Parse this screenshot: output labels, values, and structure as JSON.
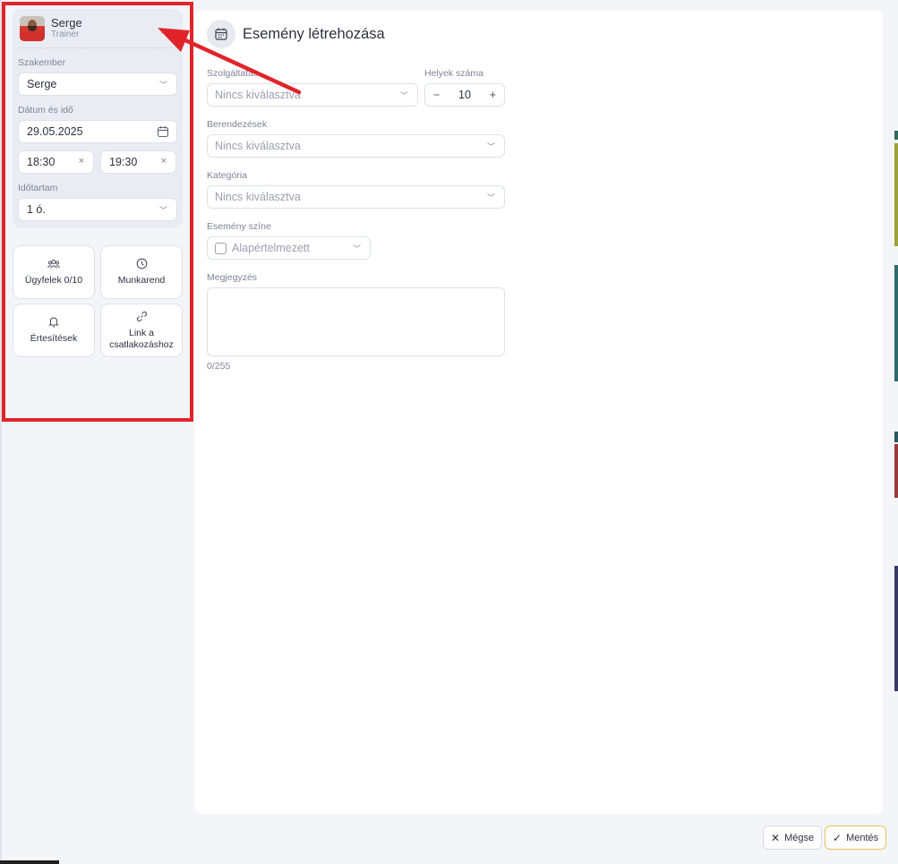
{
  "profile": {
    "name": "Serge",
    "role": "Trainer"
  },
  "sidebar": {
    "specialist_label": "Szakember",
    "specialist_value": "Serge",
    "datetime_label": "Dátum és idő",
    "date_value": "29.05.2025",
    "start_time": "18:30",
    "end_time": "19:30",
    "duration_label": "Időtartam",
    "duration_value": "1 ó.",
    "tiles": [
      {
        "label": "Ügyfelek 0/10",
        "icon": "users-icon"
      },
      {
        "label": "Munkarend",
        "icon": "clock-icon"
      },
      {
        "label": "Értesítések",
        "icon": "bell-icon"
      },
      {
        "label": "Link a csatlakozáshoz",
        "icon": "link-icon"
      }
    ]
  },
  "main": {
    "title": "Esemény létrehozása",
    "service_label": "Szolgáltatás",
    "service_placeholder": "Nincs kiválasztva",
    "seats_label": "Helyek száma",
    "seats_value": "10",
    "equipment_label": "Berendezések",
    "equipment_placeholder": "Nincs kiválasztva",
    "category_label": "Kategória",
    "category_placeholder": "Nincs kiválasztva",
    "color_label": "Esemény színe",
    "color_value": "Alapértelmezett",
    "note_label": "Megjegyzés",
    "note_counter": "0/255"
  },
  "footer": {
    "cancel_label": "Mégse",
    "save_label": "Mentés"
  },
  "colors": {
    "highlight": "#e0242a",
    "save_border": "#e5c15a",
    "panel_bg": "#e9ecf3"
  }
}
